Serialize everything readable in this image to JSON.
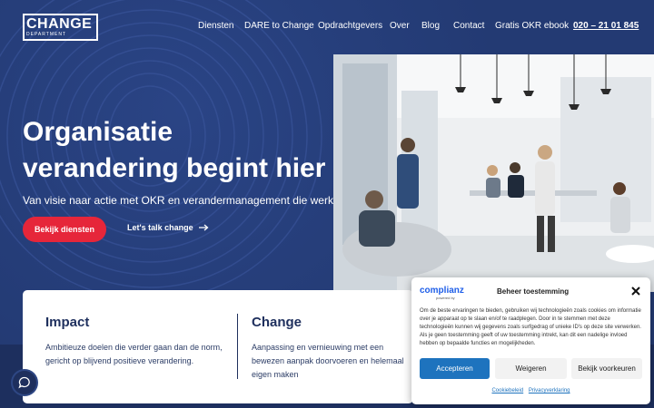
{
  "brand": {
    "logo_word": "CHANGE",
    "logo_sub": "DEPARTMENT"
  },
  "nav": {
    "items": [
      "Diensten",
      "DARE to Change",
      "Opdrachtgevers",
      "Over",
      "Blog",
      "Contact",
      "Gratis OKR ebook"
    ],
    "phone": "020 – 21 01 845"
  },
  "hero": {
    "title": "Organisatie verandering begint hier",
    "subtitle": "Van visie naar actie met OKR en verandermanagement die werken",
    "primary_cta": "Bekijk diensten",
    "secondary_cta": "Let's talk change"
  },
  "cards": [
    {
      "title": "Impact",
      "text": "Ambitieuze doelen die verder gaan dan de norm, gericht op blijvend positieve verandering."
    },
    {
      "title": "Change",
      "text": "Aanpassing en vernieuwing met een bewezen aanpak doorvoeren en helemaal eigen maken"
    }
  ],
  "cookie": {
    "logo_word": "complianz",
    "logo_sub": "powered by",
    "title": "Beheer toestemming",
    "text": "Om de beste ervaringen te bieden, gebruiken wij technologieën zoals cookies om informatie over je apparaat op te slaan en/of te raadplegen. Door in te stemmen met deze technologieën kunnen wij gegevens zoals surfgedrag of unieke ID's op deze site verwerken. Als je geen toestemming geeft of uw toestemming intrekt, kan dit een nadelige invloed hebben op bepaalde functies en mogelijkheden.",
    "accept": "Accepteren",
    "deny": "Weigeren",
    "preferences": "Bekijk voorkeuren",
    "links": [
      "Cookiebeleid",
      "Privacyverklaring"
    ]
  },
  "colors": {
    "hero_bg": "#233a73",
    "accent_red": "#e6263a",
    "accept_blue": "#1e73be",
    "navy_text": "#1e2f5d"
  },
  "icons": {
    "chat": "chat-bubble-icon",
    "close": "close-icon",
    "arrow": "arrow-right-icon"
  }
}
